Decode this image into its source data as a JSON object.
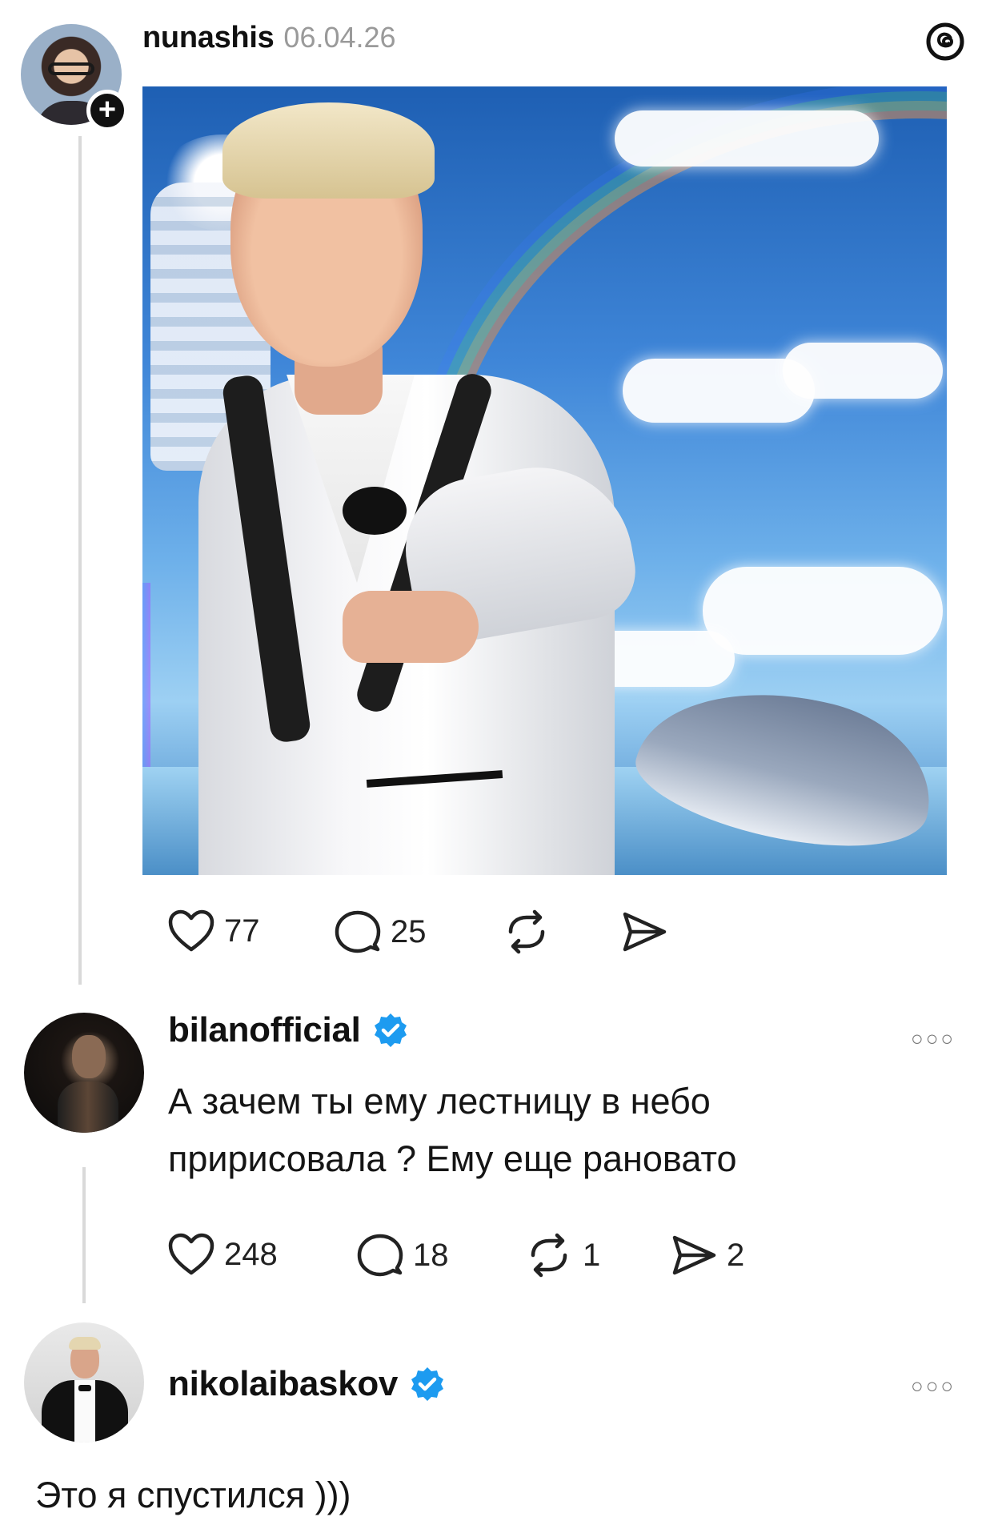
{
  "post": {
    "username": "nunashis",
    "date": "06.04.26",
    "likes": "77",
    "comments": "25"
  },
  "comment1": {
    "username": "bilanofficial",
    "text_line1": "А зачем ты ему лестницу в небо",
    "text_line2": "пририсовала ? Ему еще рановато",
    "likes": "248",
    "comments": "18",
    "reposts": "1",
    "shares": "2"
  },
  "comment2": {
    "username": "nikolaibaskov",
    "text": "Это я спустился )))"
  },
  "colors": {
    "verified_blue": "#1d9bf0",
    "thread_line": "#d9d9d9"
  },
  "icons": {
    "app_logo": "threads-icon",
    "like": "heart-icon",
    "comment": "comment-bubble-icon",
    "repost": "repost-icon",
    "share": "send-icon",
    "more": "more-dots-icon",
    "verified": "verified-badge-icon",
    "follow": "plus-icon"
  }
}
